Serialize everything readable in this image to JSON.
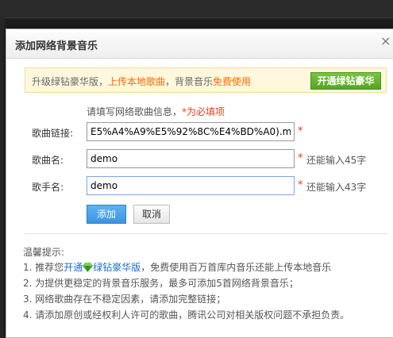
{
  "dialog": {
    "title": "添加网络背景音乐",
    "close": "×"
  },
  "promo": {
    "text_before": "升级绿钻豪华版，",
    "text_orange1": "上传本地歌曲",
    "text_middle": "，背景音乐",
    "text_orange2": "免费使用",
    "button_label": "开通绿钻豪华"
  },
  "form": {
    "hint_prefix": "请填写网络歌曲信息，",
    "hint_required": "*为必填项",
    "link_label": "歌曲链接:",
    "link_value": "E5%A4%A9%E5%92%8C%E4%BD%A0).mp3",
    "name_label": "歌曲名:",
    "name_value": "demo",
    "name_remaining": "还能输入45字",
    "singer_label": "歌手名:",
    "singer_value": "demo",
    "singer_remaining": "还能输入43字",
    "required_star": "*",
    "add_button": "添加",
    "cancel_button": "取消"
  },
  "tips": {
    "title": "温馨提示:",
    "item1_prefix": "1. 推荐您",
    "item1_link1": "开通",
    "item1_link2": "绿钻豪华版",
    "item1_suffix": "，免费使用百万首库内音乐还能上传本地音乐",
    "item2": "2. 为提供更稳定的背景音乐服务，最多可添加5首网络背景音乐；",
    "item3": "3. 网络歌曲存在不稳定因素，请添加完整链接；",
    "item4": "4. 请添加原创或经权利人许可的歌曲，腾讯公司对相关版权问题不承担负责。"
  },
  "colors": {
    "accent_orange": "#ff6a00",
    "required_red": "#e63c1e",
    "link_blue": "#1a6cc9",
    "green": "#55a521"
  },
  "icons": {
    "close": "close-icon",
    "diamond": "green-diamond-icon"
  }
}
